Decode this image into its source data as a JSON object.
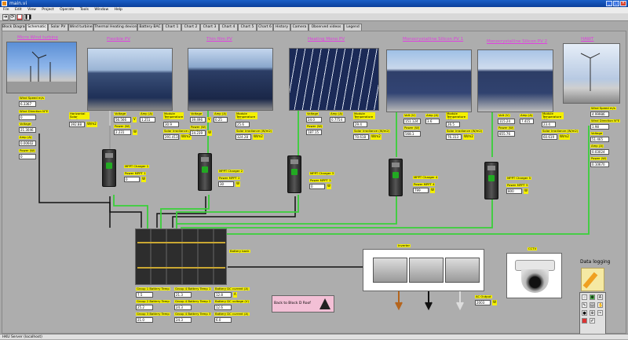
{
  "window": {
    "title": "main.vi"
  },
  "menu": [
    "File",
    "Edit",
    "View",
    "Project",
    "Operate",
    "Tools",
    "Window",
    "Help"
  ],
  "tabs": [
    "Block Diagram",
    "Schematic",
    "Solar PV",
    "Wind turbine",
    "Thermal Heating device",
    "Battery BAC",
    "Chart 1",
    "Chart 2",
    "Chart 3",
    "Chart 4",
    "Chart 5",
    "Chart 6",
    "History",
    "Camera",
    "Observed videos",
    "Legend"
  ],
  "sections": {
    "micro_wind": "Micro Wind turbine",
    "flexible_pv": "Flexible PV",
    "thin_film": "Thin film PV",
    "heating_mono": "Heating Mono PV",
    "mono1": "Monocrystalline Silicon PV 1",
    "mono2": "Monocrystalline Silicon PV 2",
    "hawt": "HAWT"
  },
  "micro_wind": {
    "l1": "Wind Speed m/s",
    "v1": "6.3367",
    "l2": "Wind Direction N°E",
    "v2": "0",
    "l3": "Voltage",
    "v3": "21.3046",
    "l4": "Amp (A)",
    "v4": "0.00602",
    "l5": "Power (W)",
    "v5": "0"
  },
  "flexible_pv": {
    "l0": "Horizontal Solar Irradiance",
    "v0": "392.88",
    "u0": "W/m2",
    "l1": "Voltage",
    "v1": "56.566",
    "u1": "V",
    "l2": "Amp (A)",
    "v2": "1.251",
    "l3": "Power (W)",
    "v3": "2.231",
    "u3": "W"
  },
  "thin_film": {
    "l1": "Module Temperature (°C)",
    "v1": "30.9",
    "l2": "Solar Irradiance (W/m2)",
    "v2": "291.413",
    "u2": "W/m2",
    "l3": "Voltage",
    "v3": "39.496",
    "u3": "V",
    "l4": "Amp (A)",
    "v4": "0.25",
    "l5": "Power (W)",
    "v5": "24.239",
    "u5": "W",
    "l6": "Module Temperature (°C)",
    "v6": "25.6",
    "l7": "Solar Irradiance (W/m2)",
    "v7": "324.28",
    "u7": "W/m2"
  },
  "heating_mono": {
    "l1": "Voltage",
    "v1": "24.0",
    "l2": "Amp (A)",
    "v2": "0.7754",
    "l3": "Power (W)",
    "v3": "187.15",
    "l4": "Module Temperature (°C)",
    "v4": "29.4",
    "l5": "Solar Irradiance (W/m2)",
    "v5": "70.618",
    "u5": "W/m2"
  },
  "mono1": {
    "l1": "Volt (V)",
    "v1": "151.124",
    "l2": "Amp (A)",
    "v2": "3.6",
    "l3": "Power (W)",
    "v3": "568.1",
    "l4": "Module Temperature (°C)",
    "v4": "26.5",
    "l5": "Solar Irradiance (W/m2)",
    "v5": "76.313",
    "u5": "W/m2"
  },
  "mono2": {
    "l1": "Volt (V)",
    "v1": "115.24",
    "l2": "Amp (A)",
    "v2": "7.415",
    "l3": "Power (W)",
    "v3": "855.76",
    "l4": "Module Temperature (°C)",
    "v4": "23.4",
    "l5": "Solar Irradiance (W/m2)",
    "v5": "60.619",
    "u5": "W/m2"
  },
  "hawt": {
    "l1": "Wind Speed m/s",
    "v1": "4.99986",
    "l2": "Wind Direction N°E",
    "v2": "1.98",
    "l3": "Voltage",
    "v3": "51.465",
    "l4": "Amp (A)",
    "v4": "0.03024",
    "l5": "Power (W)",
    "v5": "0.10670"
  },
  "chargers": [
    {
      "name": "MPPT Charger 1",
      "pl": "Power MPPT 1",
      "pv": "0",
      "u": "W"
    },
    {
      "name": "MPPT Charger 2",
      "pl": "Power MPPT 2",
      "pv": "30",
      "u": "W"
    },
    {
      "name": "MPPT Charger 3",
      "pl": "Power MPPT 3",
      "pv": "0",
      "u": "W"
    },
    {
      "name": "MPPT Charger 4",
      "pl": "Power MPPT 4",
      "pv": "799",
      "u": "W"
    },
    {
      "name": "MPPT Charger 5",
      "pl": "Power MPPT 5",
      "pv": "800",
      "u": "W"
    }
  ],
  "battery": {
    "label": "Battery bank",
    "g1": "Group 1 Battery Temp",
    "g1v": "7.5",
    "g2": "Group 2 Battery Temp",
    "g2v": "25.2",
    "g3": "Group 3 Battery Temp",
    "g3v": "21.0",
    "h1": "Group 4 Battery Temp 1",
    "h1v": "21.3",
    "h2": "Group 4 Battery Temp 2",
    "h2v": "24.3",
    "h3": "Group 4 Battery Temp 3",
    "h3v": "24.3",
    "b1": "Battery DC current (A)",
    "b1v": "12.8",
    "b2": "Battery DC voltage (V)",
    "b2v": "12.6",
    "b3": "Battery DC current (A)",
    "b3v": "6.0",
    "u": "A"
  },
  "inverter": {
    "label": "Inverter",
    "ac_label": "AC Output",
    "ac_value": "2003",
    "ac_unit": "W"
  },
  "cctv": {
    "label": "CCTV"
  },
  "data_logging": {
    "label": "Data logging"
  },
  "nav_button": {
    "label": "Back to Block D Roof"
  },
  "statusbar": {
    "text": "HKU Server (localhost)"
  }
}
